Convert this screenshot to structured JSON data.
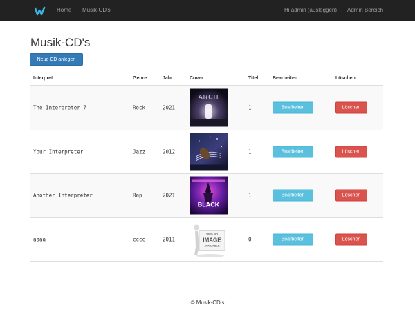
{
  "navbar": {
    "brand_icon": "w-logo-icon",
    "brand_color": "#3fb3e0",
    "links": {
      "home": "Home",
      "cds": "Musik-CD's",
      "user": "Hi admin (ausloggen)",
      "admin": "Admin Bereich"
    }
  },
  "page": {
    "title": "Musik-CD's",
    "new_button": "Neue CD anlegen"
  },
  "table": {
    "headers": {
      "interpret": "Interpret",
      "genre": "Genre",
      "year": "Jahr",
      "cover": "Cover",
      "titles": "Titel",
      "edit": "Bearbeiten",
      "delete": "Löschen"
    },
    "rows": [
      {
        "interpret": "The Interpreter 7",
        "genre": "Rock",
        "year": "2021",
        "titles": "1",
        "cover": "cover-arch",
        "cover_text": "ARCH",
        "edit": "Bearbeiten",
        "delete": "Löschen"
      },
      {
        "interpret": "Your Interpreter",
        "genre": "Jazz",
        "year": "2012",
        "titles": "1",
        "cover": "cover-violin",
        "edit": "Bearbeiten",
        "delete": "Löschen"
      },
      {
        "interpret": "Another Interpreter",
        "genre": "Rap",
        "year": "2021",
        "titles": "1",
        "cover": "cover-black",
        "cover_text": "BLACK",
        "edit": "Bearbeiten",
        "delete": "Löschen"
      },
      {
        "interpret": "aaaa",
        "genre": "cccc",
        "year": "2011",
        "titles": "0",
        "cover": "cover-no-image",
        "cover_text": [
          "100% NO",
          "IMAGE",
          "AVAILABLE"
        ],
        "edit": "Bearbeiten",
        "delete": "Löschen"
      }
    ]
  },
  "footer": {
    "text": "© Musik-CD's"
  }
}
